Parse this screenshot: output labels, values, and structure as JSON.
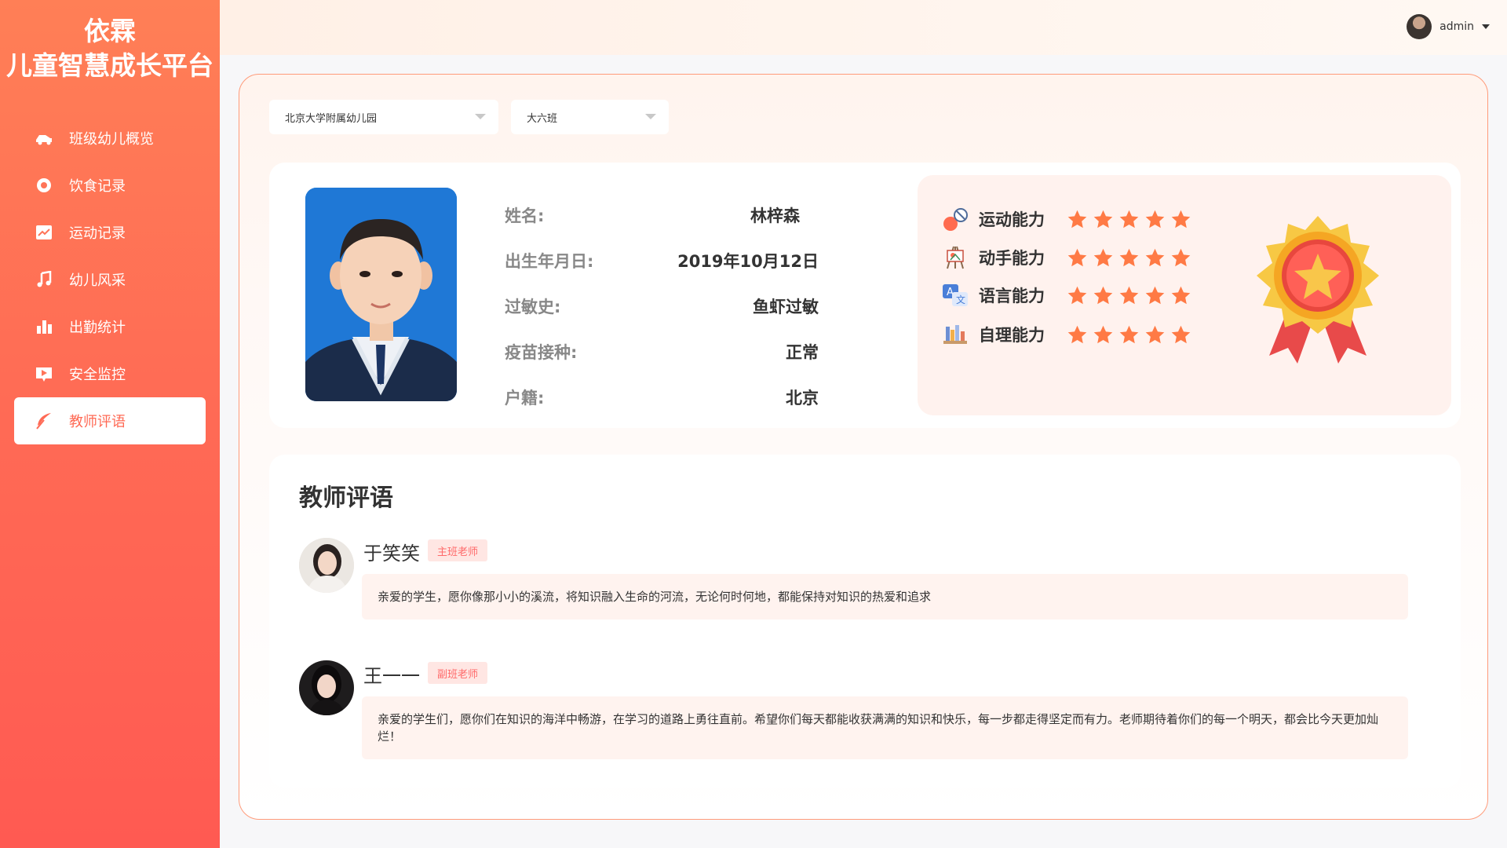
{
  "brand": {
    "line1": "依霖",
    "line2": "儿童智慧成长平台"
  },
  "sidebar": {
    "items": [
      {
        "label": "班级幼儿概览",
        "icon": "car-icon"
      },
      {
        "label": "饮食记录",
        "icon": "circle-record-icon"
      },
      {
        "label": "运动记录",
        "icon": "trend-chart-icon"
      },
      {
        "label": "幼儿风采",
        "icon": "music-note-icon"
      },
      {
        "label": "出勤统计",
        "icon": "bar-chart-icon"
      },
      {
        "label": "安全监控",
        "icon": "video-play-icon"
      },
      {
        "label": "教师评语",
        "icon": "feather-pen-icon",
        "active": true
      }
    ]
  },
  "header": {
    "username": "admin"
  },
  "filters": {
    "school": "北京大学附属幼儿园",
    "class": "大六班"
  },
  "child": {
    "fields": [
      {
        "label": "姓名:",
        "value": "林梓森"
      },
      {
        "label": "出生年月日:",
        "value": "2019年10月12日"
      },
      {
        "label": "过敏史:",
        "value": "鱼虾过敏"
      },
      {
        "label": "疫苗接种:",
        "value": "正常"
      },
      {
        "label": "户籍:",
        "value": "北京"
      }
    ]
  },
  "abilities": [
    {
      "name": "运动能力",
      "stars": 5,
      "icon": "sports-icon"
    },
    {
      "name": "动手能力",
      "stars": 5,
      "icon": "easel-icon"
    },
    {
      "name": "语言能力",
      "stars": 5,
      "icon": "translate-icon"
    },
    {
      "name": "自理能力",
      "stars": 5,
      "icon": "bookshelf-icon"
    }
  ],
  "comments": {
    "title": "教师评语",
    "items": [
      {
        "name": "于笑笑",
        "role": "主班老师",
        "text": "亲爱的学生，愿你像那小小的溪流，将知识融入生命的河流，无论何时何地，都能保持对知识的热爱和追求"
      },
      {
        "name": "王一一",
        "role": "副班老师",
        "text": "亲爱的学生们，愿你们在知识的海洋中畅游，在学习的道路上勇往直前。希望你们每天都能收获满满的知识和快乐，每一步都走得坚定而有力。老师期待着你们的每一个明天，都会比今天更加灿烂！"
      }
    ]
  },
  "colors": {
    "accent": "#ff6a55",
    "star": "#ff7a45",
    "badge_text": "#ff6a6a"
  }
}
